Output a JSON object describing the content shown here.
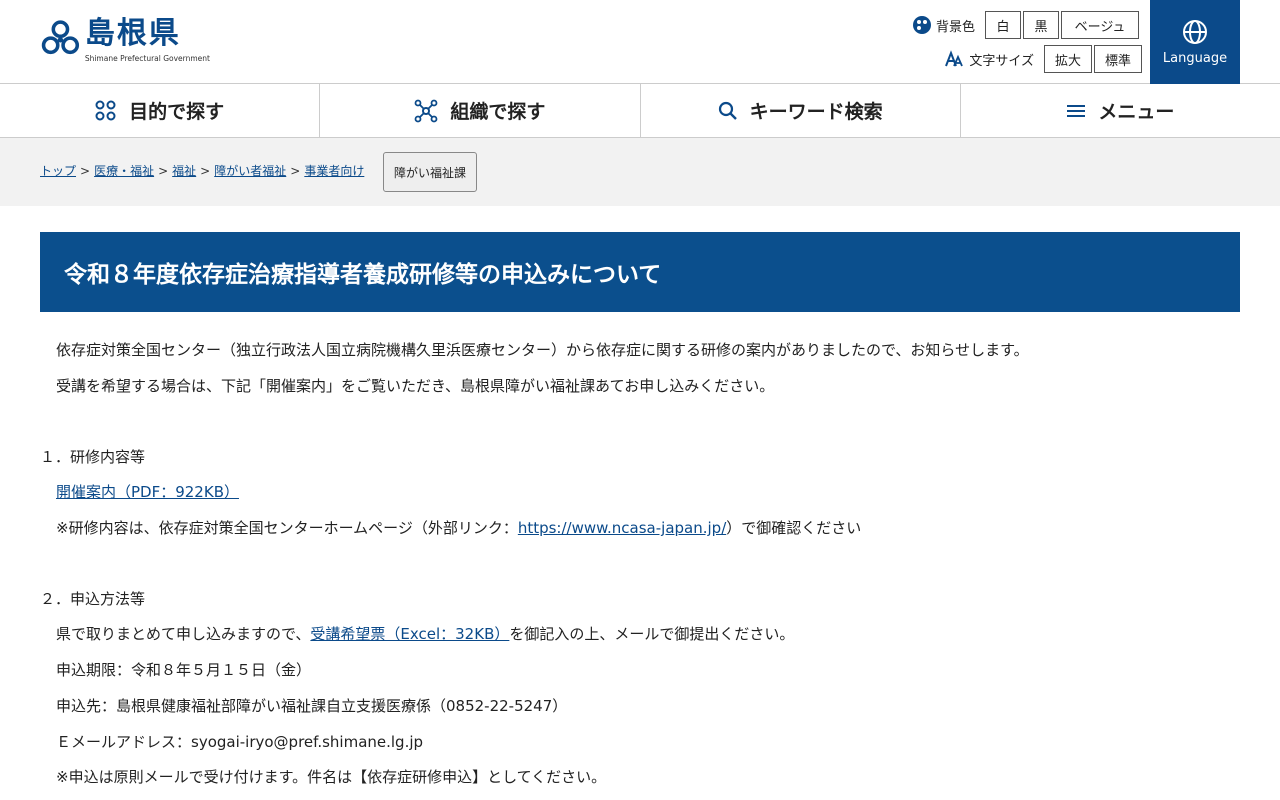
{
  "header": {
    "logo_title": "島根県",
    "logo_sub": "Shimane Prefectural Government",
    "tagline": "",
    "bg_label": "背景色",
    "bg_options": [
      "白",
      "黒",
      "ベージュ"
    ],
    "font_label": "文字サイズ",
    "font_options": [
      "拡大",
      "標準"
    ],
    "language": "Language"
  },
  "nav": {
    "items": [
      "目的で探す",
      "組織で探す",
      "キーワード検索",
      "メニュー"
    ]
  },
  "breadcrumb": {
    "items": [
      "トップ",
      "医療・福祉",
      "福祉",
      "障がい者福祉",
      "事業者向け"
    ],
    "sep": ">",
    "dept": "障がい福祉課"
  },
  "page": {
    "title": "令和８年度依存症治療指導者養成研修等の申込みについて",
    "intro1": "依存症対策全国センター（独立行政法人国立病院機構久里浜医療センター）から依存症に関する研修の案内がありましたので、お知らせします。",
    "intro2": "受講を希望する場合は、下記「開催案内」をご覧いただき、島根県障がい福祉課あてお申し込みください。",
    "sec1_heading": "１．研修内容等",
    "sec1_link": "開催案内（PDF：922KB）",
    "sec1_note_pre": "※研修内容は、依存症対策全国センターホームページ（外部リンク：",
    "sec1_note_link": "https://www.ncasa-japan.jp/",
    "sec1_note_post": "）で御確認ください",
    "sec2_heading": "２．申込方法等",
    "sec2_line1_pre": "県で取りまとめて申し込みますので、",
    "sec2_line1_link": "受講希望票（Excel：32KB）",
    "sec2_line1_post": "を御記入の上、メールで御提出ください。",
    "sec2_deadline": "申込期限：令和８年５月１５日（金）",
    "sec2_contact": "申込先：島根県健康福祉部障がい福祉課自立支援医療係（0852-22-5247）",
    "sec2_email": "Ｅメールアドレス：syogai-iryo@pref.shimane.lg.jp",
    "sec2_note": "※申込は原則メールで受け付けます。件名は【依存症研修申込】としてください。"
  },
  "colors": {
    "brand": "#0b4a8a",
    "title_bg": "#0b4f8d",
    "crumb_bg": "#f2f2f2"
  }
}
